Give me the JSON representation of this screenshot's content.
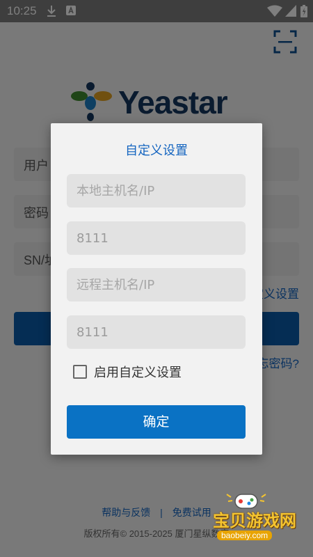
{
  "status_bar": {
    "time": "10:25"
  },
  "login_page": {
    "brand": "Yeastar",
    "username_placeholder": "用户",
    "password_placeholder": "密码",
    "sn_placeholder": "SN/址",
    "custom_settings_link": "定义设置",
    "forgot_password_link": "忘密码?",
    "footer": {
      "help_label": "帮助与反馈",
      "separator": "|",
      "trial_label": "免费试用",
      "copyright": "版权所有© 2015-2025 厦门星纵数字"
    }
  },
  "dialog": {
    "title": "自定义设置",
    "local_host_placeholder": "本地主机名/IP",
    "local_port_value": "8111",
    "remote_host_placeholder": "远程主机名/IP",
    "remote_port_value": "8111",
    "enable_label": "启用自定义设置",
    "enable_checked": false,
    "confirm_label": "确定"
  },
  "watermark": {
    "title": "宝贝游戏网",
    "url": "baobeiy.com"
  },
  "colors": {
    "accent": "#1565c0",
    "button": "#0a72c4",
    "brand_navy": "#15365f"
  }
}
